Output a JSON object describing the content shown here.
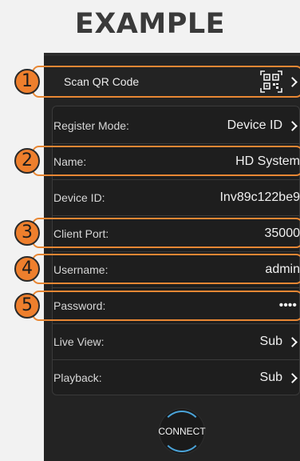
{
  "heading": "EXAMPLE",
  "scan": {
    "label": "Scan QR Code",
    "icon": "qr-code-icon"
  },
  "rows": {
    "register_mode": {
      "label": "Register Mode:",
      "value": "Device ID"
    },
    "name": {
      "label": "Name:",
      "value": "HD System"
    },
    "device_id": {
      "label": "Device ID:",
      "value": "Inv89c122be9"
    },
    "client_port": {
      "label": "Client Port:",
      "value": "35000"
    },
    "username": {
      "label": "Username:",
      "value": "admin"
    },
    "password": {
      "label": "Password:",
      "value": "••••"
    },
    "live_view": {
      "label": "Live View:",
      "value": "Sub"
    },
    "playback": {
      "label": "Playback:",
      "value": "Sub"
    }
  },
  "badges": [
    "1",
    "2",
    "3",
    "4",
    "5"
  ],
  "connect_label": "CONNECT",
  "colors": {
    "highlight": "#e88734",
    "badge": "#ee7f2d",
    "connect_ring": "#4aa3d8",
    "background": "#232323"
  }
}
